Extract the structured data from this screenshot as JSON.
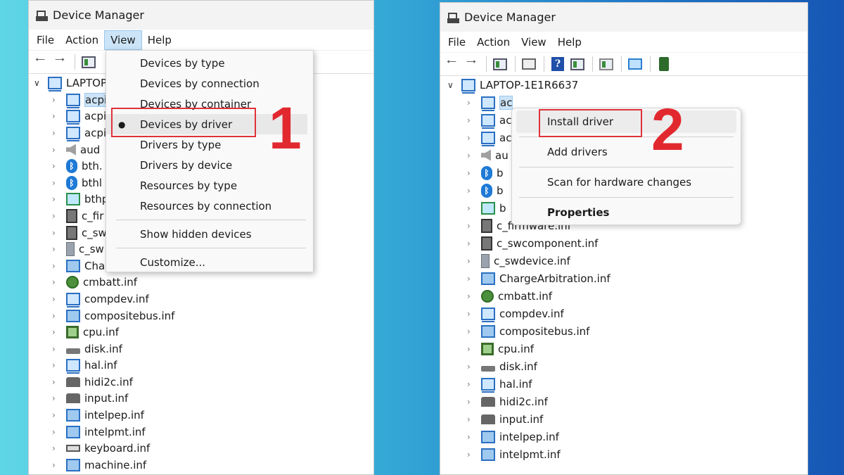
{
  "left": {
    "title": "Device Manager",
    "menus": [
      "File",
      "Action",
      "View",
      "Help"
    ],
    "root": "LAPTOP-",
    "rows": [
      {
        "label": "acpi",
        "icon": "pc"
      },
      {
        "label": "acpi",
        "icon": "pc"
      },
      {
        "label": "acpi",
        "icon": "pc"
      },
      {
        "label": "aud",
        "icon": "snd"
      },
      {
        "label": "bth.",
        "icon": "bt"
      },
      {
        "label": "bthl",
        "icon": "bt"
      },
      {
        "label": "bthp",
        "icon": "net"
      },
      {
        "label": "c_fir",
        "icon": "chip"
      },
      {
        "label": "c_sw",
        "icon": "chip"
      },
      {
        "label": "c_sw",
        "icon": "tower"
      },
      {
        "label": "Charge",
        "icon": "board"
      },
      {
        "label": "cmbatt.inf",
        "icon": "batt"
      },
      {
        "label": "compdev.inf",
        "icon": "pc"
      },
      {
        "label": "compositebus.inf",
        "icon": "board"
      },
      {
        "label": "cpu.inf",
        "icon": "cpu"
      },
      {
        "label": "disk.inf",
        "icon": "disk"
      },
      {
        "label": "hal.inf",
        "icon": "pc"
      },
      {
        "label": "hidi2c.inf",
        "icon": "hid"
      },
      {
        "label": "input.inf",
        "icon": "hid"
      },
      {
        "label": "intelpep.inf",
        "icon": "board"
      },
      {
        "label": "intelpmt.inf",
        "icon": "board"
      },
      {
        "label": "keyboard.inf",
        "icon": "kbd"
      },
      {
        "label": "machine.inf",
        "icon": "board"
      }
    ],
    "view_menu": {
      "items": [
        "Devices by type",
        "Devices by connection",
        "Devices by container",
        "Devices by driver",
        "Drivers by type",
        "Drivers by device",
        "Resources by type",
        "Resources by connection"
      ],
      "show_hidden": "Show hidden devices",
      "customize": "Customize..."
    },
    "step": "1"
  },
  "right": {
    "title": "Device Manager",
    "menus": [
      "File",
      "Action",
      "View",
      "Help"
    ],
    "root": "LAPTOP-1E1R6637",
    "rows": [
      {
        "label": "ac",
        "icon": "pc"
      },
      {
        "label": "ac",
        "icon": "pc"
      },
      {
        "label": "ac",
        "icon": "pc"
      },
      {
        "label": "au",
        "icon": "snd"
      },
      {
        "label": "b",
        "icon": "bt"
      },
      {
        "label": "b",
        "icon": "bt"
      },
      {
        "label": "b",
        "icon": "net"
      },
      {
        "label": "c_firmware.inf",
        "icon": "chip"
      },
      {
        "label": "c_swcomponent.inf",
        "icon": "chip"
      },
      {
        "label": "c_swdevice.inf",
        "icon": "tower"
      },
      {
        "label": "ChargeArbitration.inf",
        "icon": "board"
      },
      {
        "label": "cmbatt.inf",
        "icon": "batt"
      },
      {
        "label": "compdev.inf",
        "icon": "pc"
      },
      {
        "label": "compositebus.inf",
        "icon": "board"
      },
      {
        "label": "cpu.inf",
        "icon": "cpu"
      },
      {
        "label": "disk.inf",
        "icon": "disk"
      },
      {
        "label": "hal.inf",
        "icon": "pc"
      },
      {
        "label": "hidi2c.inf",
        "icon": "hid"
      },
      {
        "label": "input.inf",
        "icon": "hid"
      },
      {
        "label": "intelpep.inf",
        "icon": "board"
      },
      {
        "label": "intelpmt.inf",
        "icon": "board"
      }
    ],
    "context_menu": {
      "install": "Install driver",
      "add": "Add drivers",
      "scan": "Scan for hardware changes",
      "properties": "Properties"
    },
    "step": "2"
  },
  "colors": {
    "highlight": "#e0323a",
    "selection": "#cce4f7"
  }
}
